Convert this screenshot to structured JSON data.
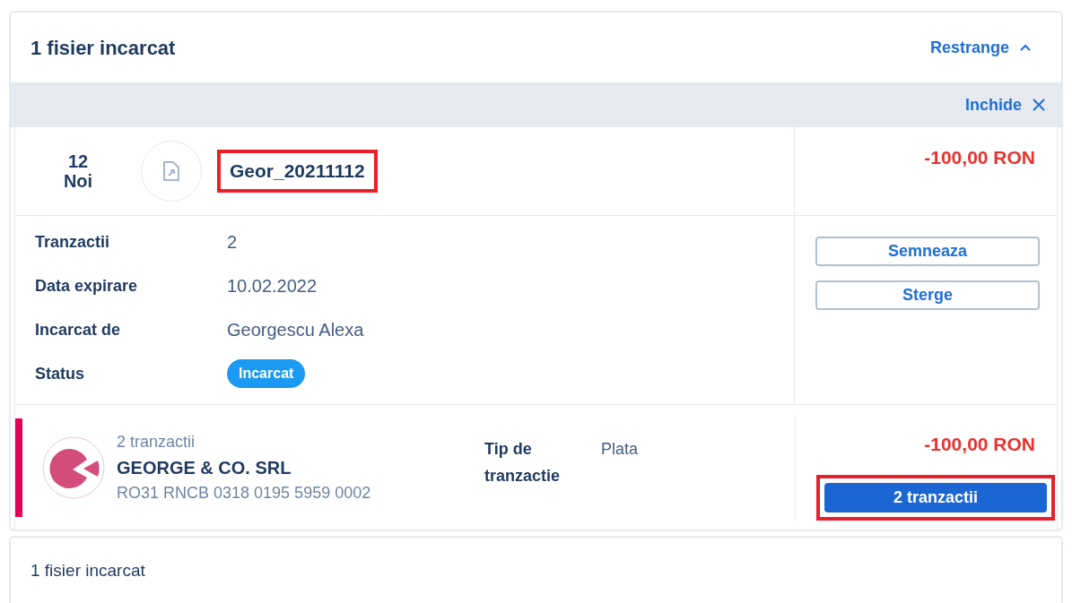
{
  "header": {
    "title": "1 fisier incarcat",
    "toggle": "Restrange",
    "expanded": true
  },
  "close_bar": {
    "label": "Inchide"
  },
  "file": {
    "day": "12",
    "month": "Noi",
    "name": "Geor_20211112",
    "name_highlighted": true,
    "amount": "-100,00 RON"
  },
  "details": [
    {
      "label": "Tranzactii",
      "value": "2",
      "kind": "text"
    },
    {
      "label": "Data expirare",
      "value": "10.02.2022",
      "kind": "text"
    },
    {
      "label": "Incarcat de",
      "value": "Georgescu Alexa",
      "kind": "text"
    },
    {
      "label": "Status",
      "value": "Incarcat",
      "kind": "badge"
    }
  ],
  "actions": [
    "Semneaza",
    "Sterge"
  ],
  "transaction": {
    "count": "2 tranzactii",
    "company": "GEORGE & CO. SRL",
    "iban": "RO31 RNCB 0318 0195 5959 0002",
    "type_label": "Tip de tranzactie",
    "type_value": "Plata",
    "amount": "-100,00 RON",
    "button": "2 tranzactii",
    "button_highlighted": true
  },
  "footer": "1 fisier incarcat"
}
